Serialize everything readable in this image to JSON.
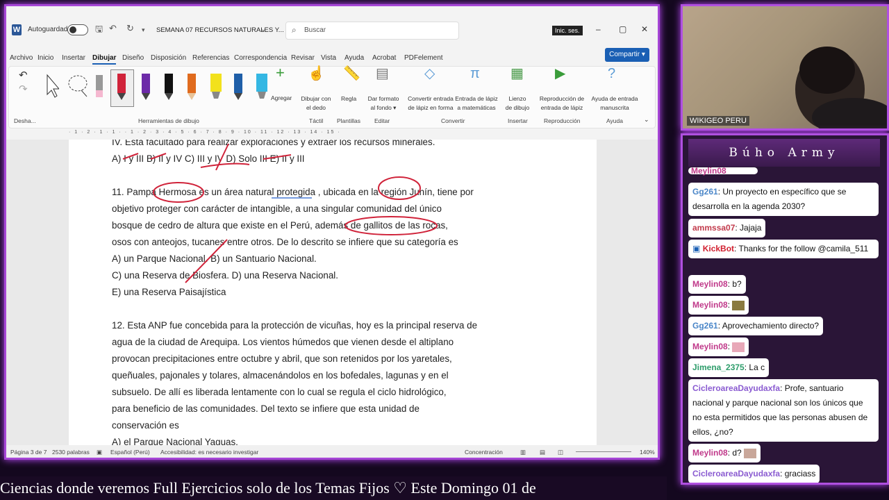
{
  "word": {
    "autosave": "Autoguardado",
    "doc_title": "SEMANA 07 RECURSOS NATURALES Y...",
    "search_placeholder": "Buscar",
    "signin": "Inic. ses.",
    "share": "Compartir",
    "menus": [
      "Archivo",
      "Inicio",
      "Insertar",
      "Dibujar",
      "Diseño",
      "Disposición",
      "Referencias",
      "Correspondencia",
      "Revisar",
      "Vista",
      "Ayuda",
      "Acrobat",
      "PDFelement"
    ],
    "ribbon": {
      "undo_group": "Desha...",
      "tools_group": "Herramientas de dibujo",
      "add": "Agregar",
      "draw_finger": [
        "Dibujar con",
        "el dedo"
      ],
      "tactil": "Táctil",
      "rule": "Regla",
      "templates": "Plantillas",
      "bg": [
        "Dar formato",
        "al fondo"
      ],
      "edit": "Editar",
      "ink_shape": [
        "Convertir entrada",
        "de lápiz en forma"
      ],
      "ink_math": [
        "Entrada de lápiz",
        "a matemáticas"
      ],
      "convert": "Convertir",
      "canvas": [
        "Lienzo",
        "de dibujo"
      ],
      "insert": "Insertar",
      "replay": [
        "Reproducción de",
        "entrada de lápiz"
      ],
      "replay_group": "Reproducción",
      "help_ink": [
        "Ayuda de entrada",
        "manuscrita"
      ],
      "help_group": "Ayuda"
    },
    "pen_colors": [
      "#9e9e9e",
      "#d0233a",
      "#6d2aa8",
      "#111111",
      "#e06b1e",
      "#f2e11c",
      "#1f5fa8",
      "#34b7e3"
    ],
    "ruler": "· 1 · 2 · 1 · 1 · · 1 · 2 · 3 · 4 · 5 · 6 · 7 · 8 · 9 · 10 · 11 · 12 · 13 · 14 · 15 ·",
    "lines": [
      "IV. Está facultado para realizar exploraciones y extraer los recursos minerales.",
      "A) I y III B) II y IV C) III y IV D) Solo III E) II y III",
      "11. Pampa Hermosa es un área natural protegida , ubicada en la región Junín, tiene por",
      "objetivo proteger con carácter de intangible, a una singular comunidad del único",
      "bosque de cedro de altura que existe en el Perú, además de gallitos de las rocas,",
      "osos con anteojos, tucanes entre otros. De lo descrito se infiere que su categoría es",
      "A) un Parque Nacional. B) un Santuario Nacional.",
      "C) una Reserva de Biosfera. D) una Reserva Nacional.",
      "E) una Reserva Paisajística",
      "12. Esta ANP fue concebida para la protección de vicuñas, hoy es la principal reserva de",
      "agua de la ciudad de Arequipa. Los vientos húmedos que vienen desde el altiplano",
      "provocan precipitaciones entre octubre y abril, que son retenidos por los yaretales,",
      "queñuales, pajonales y tolares, almacenándolos en los bofedales, lagunas y en el",
      "subsuelo. De allí es liberada lentamente con lo cual se regula el ciclo hidrológico,",
      "para beneficio de las comunidades. Del texto se infiere que esta unidad de",
      "conservación es",
      "A) el Parque Nacional Yaguas."
    ],
    "status": {
      "page": "Página 3 de 7",
      "words": "2530 palabras",
      "lang": "Español (Perú)",
      "access": "Accesibilidad: es necesario investigar",
      "focus": "Concentración",
      "zoom": "140%"
    }
  },
  "camera": {
    "label": "WIKIGEO PERU"
  },
  "chat": {
    "title": "Búho Army",
    "messages": [
      {
        "user": "Meylin08",
        "text": "",
        "color": "#c0398a"
      },
      {
        "user": "Gg261",
        "text": ": Un proyecto en específico que se desarrolla en la agenda 2030?",
        "color": "#4a86c8"
      },
      {
        "user": "ammssa07",
        "text": ": Jajaja",
        "color": "#c23b4c"
      },
      {
        "user": "KickBot",
        "text": ": Thanks for the follow @camila_511",
        "color": "#d11f2f"
      },
      {
        "user": "Meylin08",
        "text": ": b?",
        "color": "#c0398a"
      },
      {
        "user": "Meylin08",
        "text": ":",
        "color": "#c0398a"
      },
      {
        "user": "Gg261",
        "text": ": Aprovechamiento directo?",
        "color": "#4a86c8"
      },
      {
        "user": "Meylin08",
        "text": ":",
        "color": "#c0398a"
      },
      {
        "user": "Jimena_2375",
        "text": ": La c",
        "color": "#2e9d6b"
      },
      {
        "user": "CicleroareaDayudaxfa",
        "text": ": Profe, santuario nacional y parque nacional son los únicos que no esta permitidos que las personas abusen de ellos, ¿no?",
        "color": "#8a5bd1"
      },
      {
        "user": "Meylin08",
        "text": ": d?",
        "color": "#c0398a"
      },
      {
        "user": "CicleroareaDayudaxfa",
        "text": ": graciass",
        "color": "#8a5bd1"
      }
    ]
  },
  "ticker": "Ciencias donde veremos Full Ejercicios solo de los Temas Fijos     ♡     Este Domingo 01 de"
}
